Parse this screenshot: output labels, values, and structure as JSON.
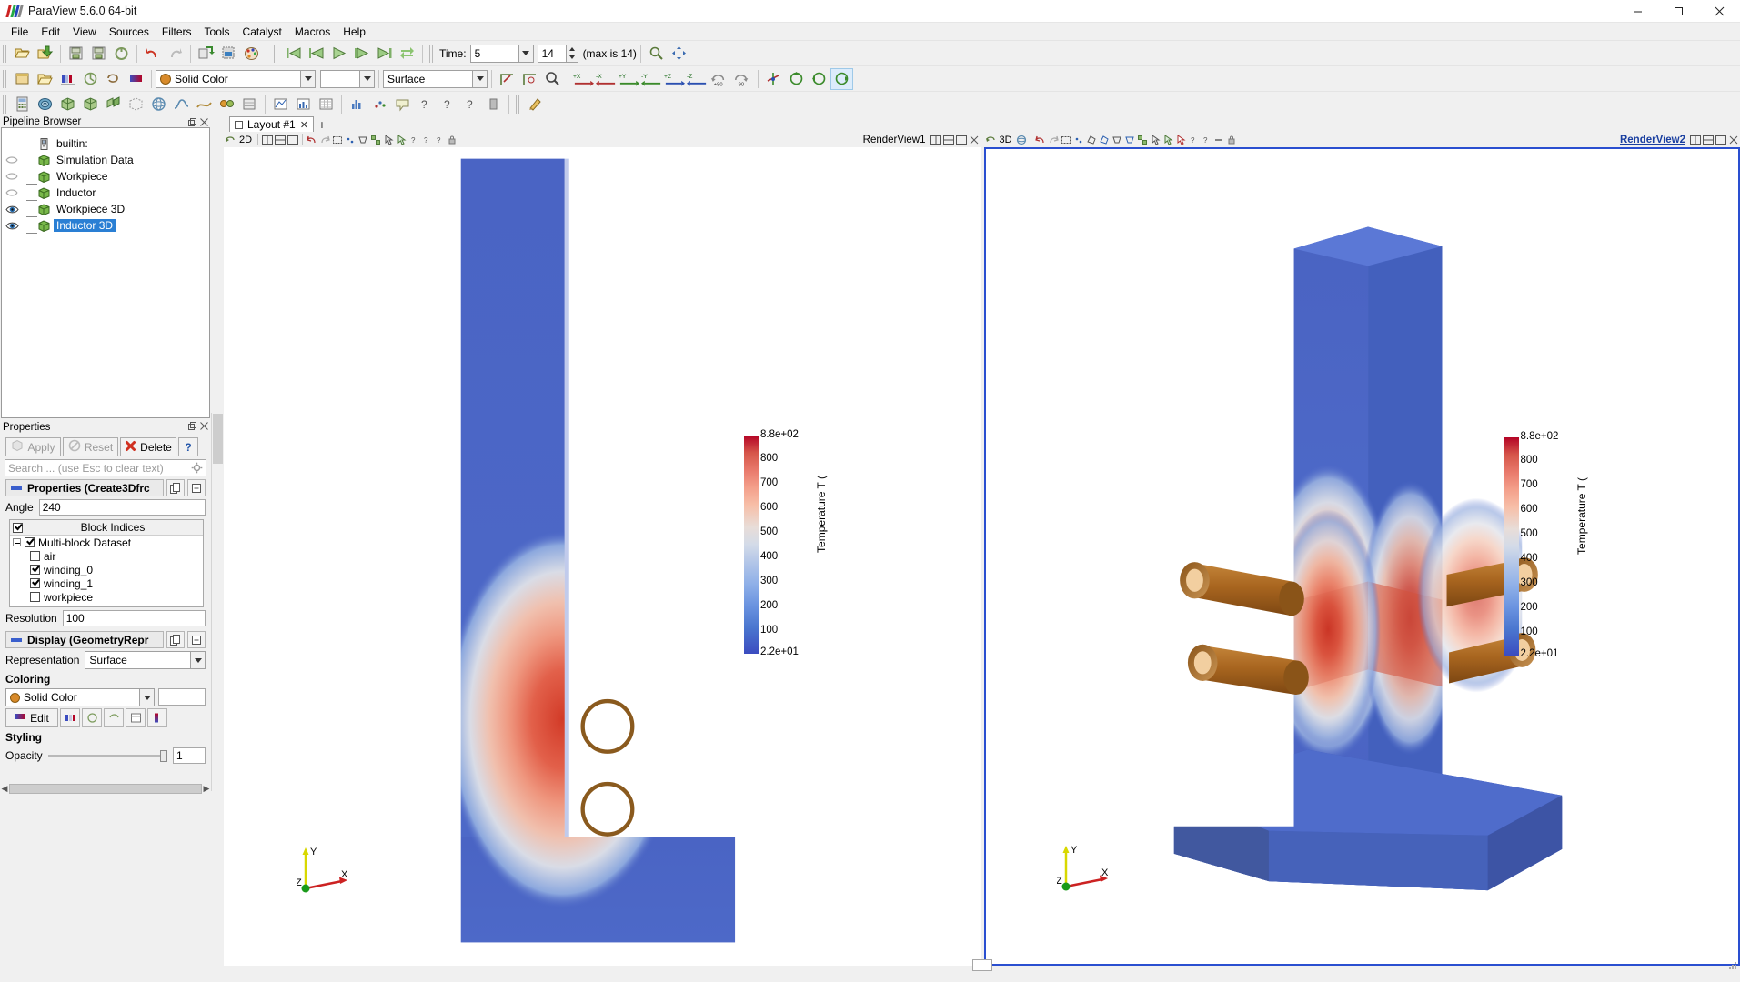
{
  "window": {
    "title": "ParaView 5.6.0 64-bit",
    "minimize": "─",
    "maximize": "☐",
    "close": "✕"
  },
  "menubar": [
    "File",
    "Edit",
    "View",
    "Sources",
    "Filters",
    "Tools",
    "Catalyst",
    "Macros",
    "Help"
  ],
  "toolbar_time": {
    "label": "Time:",
    "value": "5",
    "frame_index": "14",
    "max_text": "(max is 14)"
  },
  "toolbar_rep": {
    "coloring_value": "Solid Color",
    "array_value": "",
    "representation_value": "Surface"
  },
  "panels": {
    "pipeline_browser": {
      "title": "Pipeline Browser",
      "items": [
        {
          "label": "builtin:",
          "indent": 0,
          "eye": "none",
          "icon": "server-icon",
          "selected": false
        },
        {
          "label": "Simulation Data",
          "indent": 1,
          "eye": "hidden",
          "icon": "cube-icon",
          "selected": false
        },
        {
          "label": "Workpiece",
          "indent": 2,
          "eye": "hidden",
          "icon": "cube-icon",
          "selected": false
        },
        {
          "label": "Inductor",
          "indent": 2,
          "eye": "hidden",
          "icon": "cube-icon",
          "selected": false
        },
        {
          "label": "Workpiece 3D",
          "indent": 2,
          "eye": "visible",
          "icon": "cube-icon",
          "selected": false
        },
        {
          "label": "Inductor 3D",
          "indent": 2,
          "eye": "visible",
          "icon": "cube-icon",
          "selected": true
        }
      ]
    },
    "properties": {
      "title": "Properties",
      "apply_label": "Apply",
      "reset_label": "Reset",
      "delete_label": "Delete",
      "help_label": "?",
      "search_placeholder": "Search ... (use Esc to clear text)",
      "group_properties_title": "Properties (Create3Dfrc",
      "angle_label": "Angle",
      "angle_value": "240",
      "block_indices_header": "Block Indices",
      "blocks": [
        {
          "label": "Multi-block Dataset",
          "checked": true,
          "depth": 0
        },
        {
          "label": "air",
          "checked": false,
          "depth": 1
        },
        {
          "label": "winding_0",
          "checked": true,
          "depth": 1
        },
        {
          "label": "winding_1",
          "checked": true,
          "depth": 1
        },
        {
          "label": "workpiece",
          "checked": false,
          "depth": 1
        }
      ],
      "resolution_label": "Resolution",
      "resolution_value": "100",
      "group_display_title": "Display (GeometryRepr",
      "representation_label": "Representation",
      "representation_value": "Surface",
      "coloring_label": "Coloring",
      "coloring_value": "Solid Color",
      "edit_label": "Edit",
      "styling_label": "Styling",
      "opacity_label": "Opacity",
      "opacity_value": "1"
    }
  },
  "layout": {
    "tab_label": "Layout #1",
    "tab_close": "✕",
    "add_tab": "+"
  },
  "views": [
    {
      "name": "RenderView1",
      "active": false,
      "mode_label": "2D",
      "axes": {
        "x": "X",
        "y": "Y",
        "z": "Z"
      },
      "scalar_bar": {
        "title": "Temperature T (",
        "max_label": "8.8e+02",
        "min_label": "2.2e+01",
        "ticks": [
          "800",
          "700",
          "600",
          "500",
          "400",
          "300",
          "200",
          "100"
        ]
      }
    },
    {
      "name": "RenderView2",
      "active": true,
      "mode_label": "3D",
      "axes": {
        "x": "X",
        "y": "Y",
        "z": "Z"
      },
      "scalar_bar": {
        "title": "Temperature T (",
        "max_label": "8.8e+02",
        "min_label": "2.2e+01",
        "ticks": [
          "800",
          "700",
          "600",
          "500",
          "400",
          "300",
          "200",
          "100"
        ]
      }
    }
  ],
  "colors": {
    "colormap_hot": "#b40426",
    "colormap_cold": "#3b4cc0",
    "selection_blue": "#2a7fd4",
    "active_view_border": "#2a4fd0",
    "copper": "#a8651f"
  },
  "statusbar": {
    "progress_text": ""
  },
  "chart_data": {
    "type": "heatmap",
    "title": "Temperature T (",
    "colorbar_min": 22,
    "colorbar_max": 880,
    "ticks": [
      100,
      200,
      300,
      400,
      500,
      600,
      700,
      800
    ],
    "unit_label": "Temperature T (",
    "min_label": "2.2e+01",
    "max_label": "8.8e+02"
  }
}
